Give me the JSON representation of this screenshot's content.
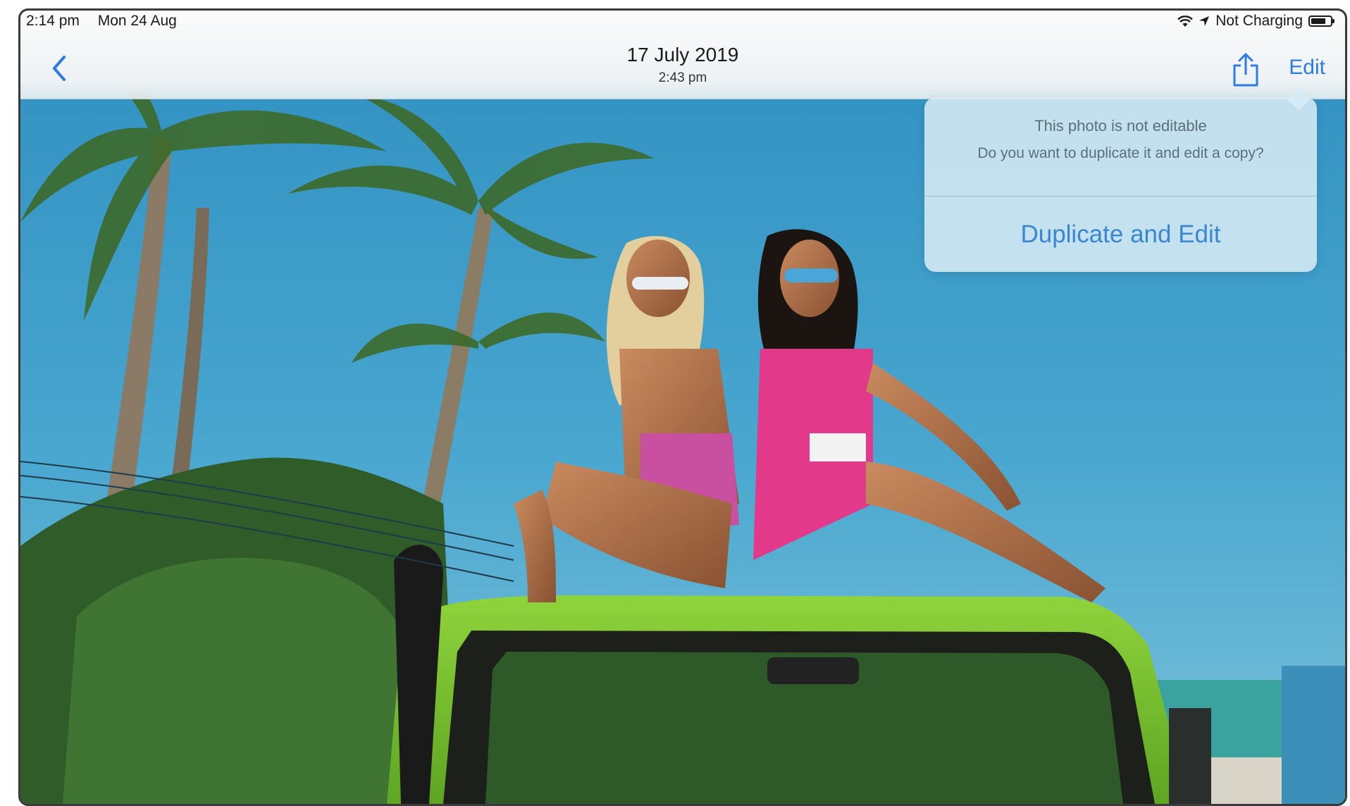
{
  "status_bar": {
    "time": "2:14 pm",
    "date": "Mon 24 Aug",
    "charging": "Not Charging",
    "wifi_icon": "wifi-icon",
    "location_icon": "location-arrow-icon",
    "battery_icon": "battery-icon"
  },
  "nav": {
    "title_date": "17 July 2019",
    "title_time": "2:43 pm",
    "back_icon": "chevron-left-icon",
    "share_icon": "share-icon",
    "edit_label": "Edit"
  },
  "popover": {
    "title": "This photo is not editable",
    "message": "Do you want to duplicate it and edit a copy?",
    "action_label": "Duplicate and Edit"
  },
  "colors": {
    "accent": "#2c7be5",
    "popover_action": "#3a86cf",
    "popover_bg": "#d6ebf4"
  }
}
